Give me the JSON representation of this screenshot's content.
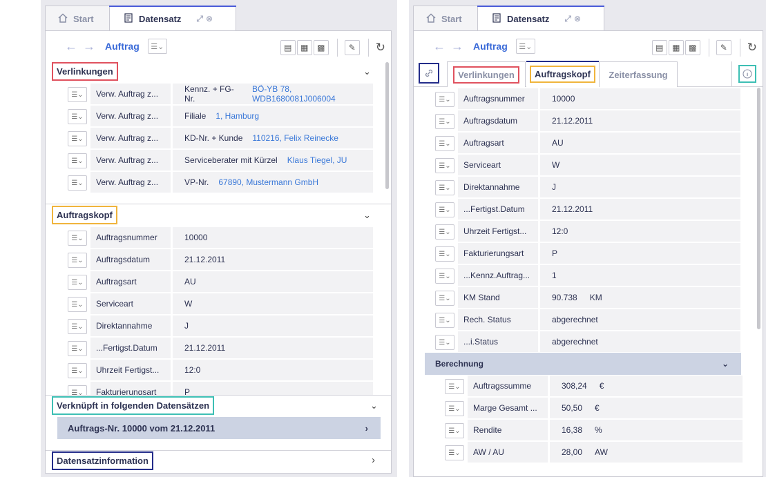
{
  "tabs": {
    "start": "Start",
    "dataset": "Datensatz"
  },
  "toolbar": {
    "title": "Auftrag"
  },
  "icons": [
    "home-icon",
    "document-icon",
    "expand-icon",
    "close-icon",
    "back-arrow-icon",
    "forward-arrow-icon",
    "menu-icon",
    "table-view-icon",
    "chart-view-icon",
    "grid-view-icon",
    "edit-icon",
    "refresh-icon",
    "link-icon",
    "info-icon",
    "chevron-down-icon",
    "chevron-right-icon"
  ],
  "colors": {
    "red": "#e0515e",
    "yellow": "#f0b43c",
    "teal": "#3dbfb4",
    "navy": "#232c8a",
    "link": "#3a78d8",
    "accent": "#4a5bd8"
  },
  "left": {
    "links_section": {
      "title": "Verlinkungen",
      "rows": [
        {
          "label": "Verw. Auftrag z...",
          "field": "Kennz. + FG-Nr.",
          "value": "BÖ-YB 78, WDB1680081J006004"
        },
        {
          "label": "Verw. Auftrag z...",
          "field": "Filiale",
          "value": "1, Hamburg"
        },
        {
          "label": "Verw. Auftrag z...",
          "field": "KD-Nr. + Kunde",
          "value": "110216, Felix Reinecke"
        },
        {
          "label": "Verw. Auftrag z...",
          "field": "Serviceberater mit Kürzel",
          "value": "Klaus Tiegel, JU"
        },
        {
          "label": "Verw. Auftrag z...",
          "field": "VP-Nr.",
          "value": "67890, Mustermann GmbH"
        }
      ]
    },
    "head_section": {
      "title": "Auftragskopf",
      "rows": [
        {
          "label": "Auftragsnummer",
          "value": "10000"
        },
        {
          "label": "Auftragsdatum",
          "value": "21.12.2011"
        },
        {
          "label": "Auftragsart",
          "value": "AU"
        },
        {
          "label": "Serviceart",
          "value": "W"
        },
        {
          "label": "Direktannahme",
          "value": "J"
        },
        {
          "label": "...Fertigst.Datum",
          "value": "21.12.2011"
        },
        {
          "label": "Uhrzeit Fertigst...",
          "value": "12:0"
        },
        {
          "label": "Fakturierungsart",
          "value": "P"
        }
      ]
    },
    "linked_section": {
      "title": "Verknüpft in folgenden Datensätzen",
      "item": "Auftrags-Nr. 10000 vom 21.12.2011"
    },
    "info_section": {
      "title": "Datensatzinformation"
    }
  },
  "right": {
    "subtabs": [
      "Verlinkungen",
      "Auftragskopf",
      "Zeiterfassung"
    ],
    "rows": [
      {
        "label": "Auftragsnummer",
        "value": "10000",
        "unit": ""
      },
      {
        "label": "Auftragsdatum",
        "value": "21.12.2011",
        "unit": ""
      },
      {
        "label": "Auftragsart",
        "value": "AU",
        "unit": ""
      },
      {
        "label": "Serviceart",
        "value": "W",
        "unit": ""
      },
      {
        "label": "Direktannahme",
        "value": "J",
        "unit": ""
      },
      {
        "label": "...Fertigst.Datum",
        "value": "21.12.2011",
        "unit": ""
      },
      {
        "label": "Uhrzeit Fertigst...",
        "value": "12:0",
        "unit": ""
      },
      {
        "label": "Fakturierungsart",
        "value": "P",
        "unit": ""
      },
      {
        "label": "...Kennz.Auftrag...",
        "value": "1",
        "unit": ""
      },
      {
        "label": "KM Stand",
        "value": "90.738",
        "unit": "KM"
      },
      {
        "label": "Rech. Status",
        "value": "abgerechnet",
        "unit": ""
      },
      {
        "label": "...i.Status",
        "value": "abgerechnet",
        "unit": ""
      }
    ],
    "calc_section": {
      "title": "Berechnung",
      "rows": [
        {
          "label": "Auftragssumme",
          "value": "308,24",
          "unit": "€"
        },
        {
          "label": "Marge Gesamt ...",
          "value": "50,50",
          "unit": "€"
        },
        {
          "label": "Rendite",
          "value": "16,38",
          "unit": "%"
        },
        {
          "label": "AW / AU",
          "value": "28,00",
          "unit": "AW"
        }
      ]
    }
  }
}
